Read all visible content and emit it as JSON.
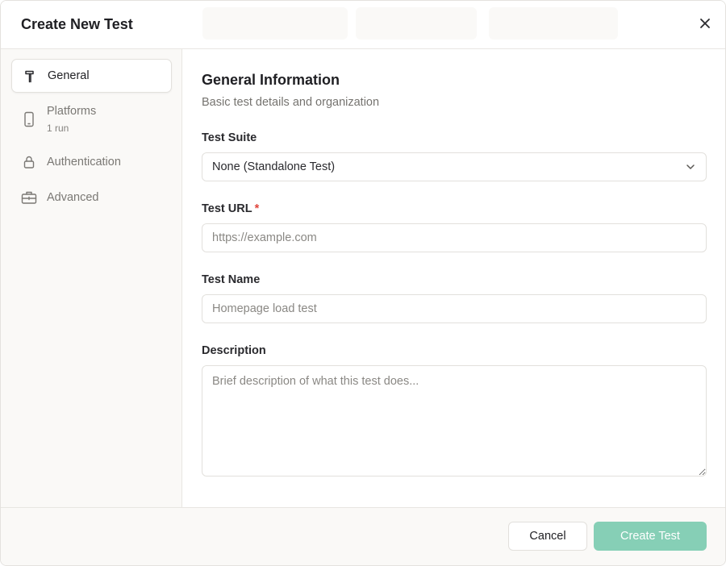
{
  "dialog": {
    "title": "Create New Test",
    "close_icon": "close-icon"
  },
  "sidebar": {
    "items": [
      {
        "id": "general",
        "label": "General",
        "sub": "",
        "icon": "hammer-icon",
        "active": true
      },
      {
        "id": "platforms",
        "label": "Platforms",
        "sub": "1 run",
        "icon": "phone-icon",
        "active": false
      },
      {
        "id": "authentication",
        "label": "Authentication",
        "sub": "",
        "icon": "lock-icon",
        "active": false
      },
      {
        "id": "advanced",
        "label": "Advanced",
        "sub": "",
        "icon": "toolbox-icon",
        "active": false
      }
    ]
  },
  "main": {
    "section_title": "General Information",
    "section_subtitle": "Basic test details and organization",
    "fields": {
      "test_suite": {
        "label": "Test Suite",
        "value": "None (Standalone Test)"
      },
      "test_url": {
        "label": "Test URL",
        "required_mark": "*",
        "value": "",
        "placeholder": "https://example.com"
      },
      "test_name": {
        "label": "Test Name",
        "value": "",
        "placeholder": "Homepage load test"
      },
      "description": {
        "label": "Description",
        "value": "",
        "placeholder": "Brief description of what this test does..."
      }
    }
  },
  "footer": {
    "cancel_label": "Cancel",
    "create_label": "Create Test"
  },
  "colors": {
    "primary_disabled": "#86cfb6",
    "required": "#e0453c",
    "sidebar_bg": "#faf9f7"
  }
}
